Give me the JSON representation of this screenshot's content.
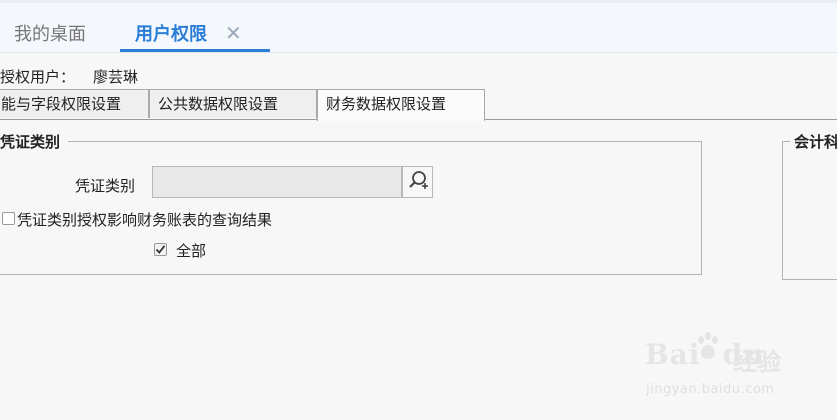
{
  "header": {
    "tabs": [
      {
        "label": "我的桌面"
      },
      {
        "label": "用户权限",
        "close_glyph": "✕"
      }
    ]
  },
  "user_row": {
    "label": "授权用户：",
    "name": "廖芸琳"
  },
  "subtabs": [
    {
      "label": "能与字段权限设置"
    },
    {
      "label": "公共数据权限设置"
    },
    {
      "label": "财务数据权限设置",
      "active": true
    }
  ],
  "voucher_group": {
    "title": "凭证类别",
    "field_label": "凭证类别",
    "field_value": "",
    "lookup_icon": "search-icon",
    "checkbox_affect_label": "凭证类别授权影响财务账表的查询结果",
    "checkbox_affect_checked": false,
    "checkbox_all_label": "全部",
    "checkbox_all_checked": true
  },
  "right_group": {
    "title": "会计科"
  },
  "watermark": {
    "brand": "Bai",
    "brand_suffix": "du",
    "cn": "经验",
    "url": "jingyan.baidu.com"
  },
  "colors": {
    "accent": "#2a7ed8",
    "header_bg": "#f4f7fc",
    "page_bg": "#f7f7f7"
  }
}
